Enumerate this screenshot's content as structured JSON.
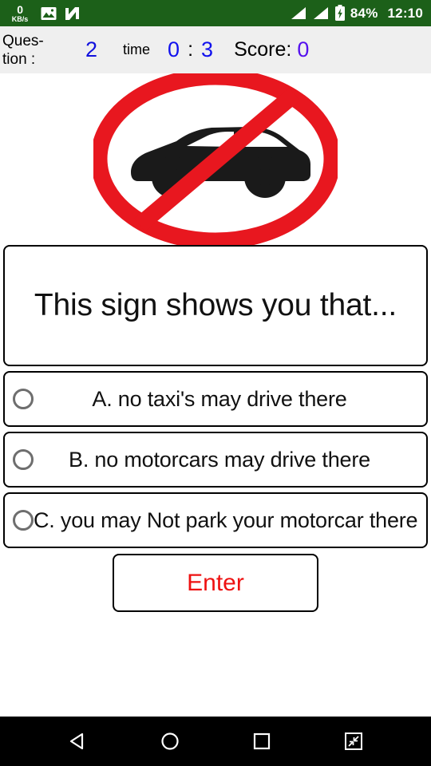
{
  "statusbar": {
    "network_speed_value": "0",
    "network_speed_unit": "KB/s",
    "gallery_icon": "image-icon",
    "nougat_icon": "android-n-icon",
    "signal_icon_1": "signal-bars-icon",
    "signal_icon_2": "signal-bars-icon",
    "battery_icon": "battery-charging-icon",
    "battery_percent": "84%",
    "time": "12:10",
    "bg_color": "#1c6019",
    "fg_color": "#ffffff"
  },
  "header": {
    "question_label": "Ques-tion :",
    "question_number": "2",
    "time_label": "time",
    "timer_minutes": "0",
    "timer_separator": ":",
    "timer_seconds": "3",
    "score_label": "Score:",
    "score_value": "0",
    "number_color": "#1111ee",
    "score_color": "#5511ee",
    "bg_color": "#efefef"
  },
  "sign": {
    "name": "no-motorcars-road-sign",
    "description": "red prohibition ellipse with diagonal slash over black car silhouette",
    "ring_color": "#e8171f",
    "car_color": "#1a1a1a",
    "plate_color": "#ffffff"
  },
  "question": {
    "text": "This sign shows you that..."
  },
  "options": [
    {
      "id": "A",
      "letter": "A.",
      "text": "A.  no taxi's may drive there",
      "selected": false,
      "radio_icon": "radio-unchecked-icon"
    },
    {
      "id": "B",
      "letter": "B.",
      "text": "B.  no motorcars may drive there",
      "selected": false,
      "radio_icon": "radio-unchecked-icon"
    },
    {
      "id": "C",
      "letter": "C.",
      "text": "C.  you may Not park your motorcar there",
      "selected": false,
      "radio_icon": "radio-unchecked-icon"
    }
  ],
  "enter_button": {
    "label": "Enter",
    "text_color": "#ee1111"
  },
  "navbar": {
    "back_icon": "back-triangle-icon",
    "home_icon": "home-circle-icon",
    "recents_icon": "recents-square-icon",
    "shrink_icon": "shrink-screen-icon",
    "bg_color": "#000000"
  }
}
